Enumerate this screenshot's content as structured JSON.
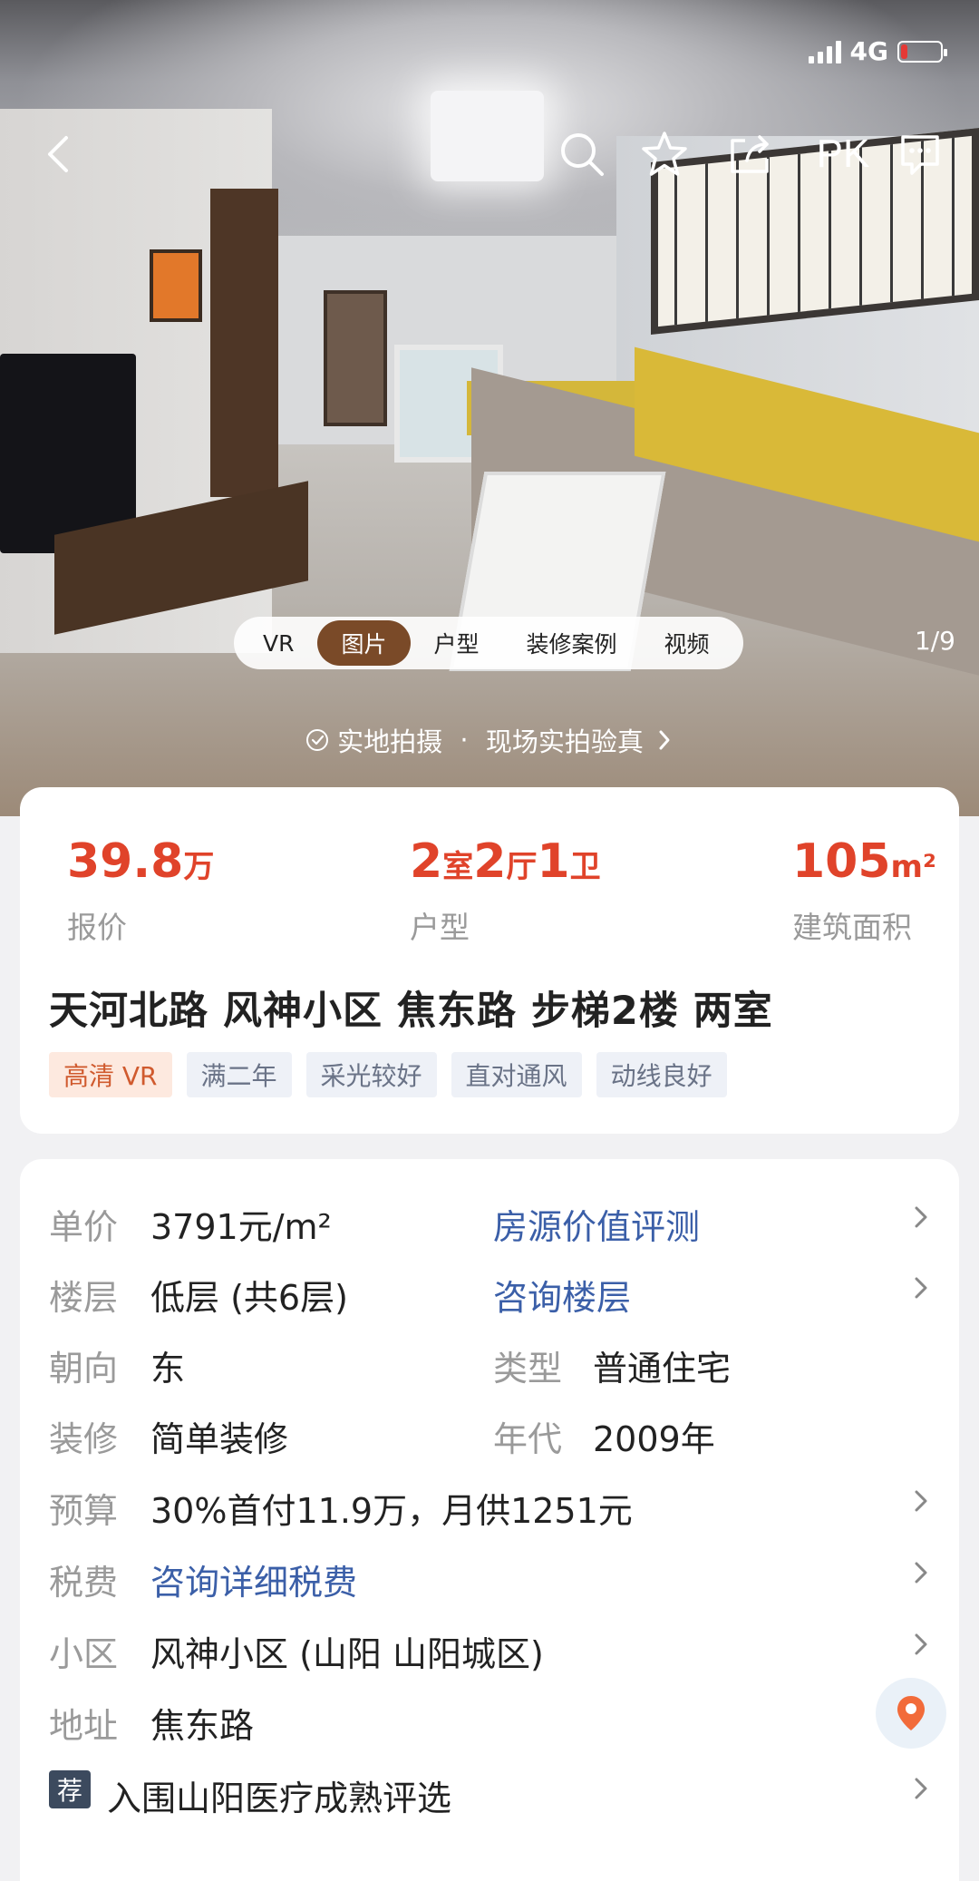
{
  "status_bar": {
    "network": "4G",
    "battery_level": 0.16,
    "battery_color": "#e53935"
  },
  "nav": {
    "back_icon": "back-arrow-icon",
    "search_icon": "search-icon",
    "favorite_icon": "star-icon",
    "share_icon": "share-icon",
    "pk_label": "PK",
    "message_icon": "message-icon"
  },
  "media_tabs": [
    {
      "label": "VR"
    },
    {
      "label": "图片"
    },
    {
      "label": "户型"
    },
    {
      "label": "装修案例"
    },
    {
      "label": "视频"
    }
  ],
  "media_active": "图片",
  "photo_counter": "1/9",
  "verify_banner": {
    "left": "实地拍摄",
    "sep": "·",
    "right": "现场实拍验真"
  },
  "summary": {
    "price": {
      "num": "39.8",
      "unit": "万",
      "label": "报价"
    },
    "layout": {
      "n1": "2",
      "u1": "室",
      "n2": "2",
      "u2": "厅",
      "n3": "1",
      "u3": "卫",
      "label": "户型"
    },
    "area": {
      "num": "105",
      "unit": "m²",
      "label": "建筑面积"
    },
    "title": "天河北路 风神小区 焦东路 步梯2楼 两室",
    "tags": [
      "高清 VR",
      "满二年",
      "采光较好",
      "直对通风",
      "动线良好"
    ]
  },
  "details": {
    "unit_price": {
      "label": "单价",
      "value": "3791元/m²",
      "link": "房源价值评测"
    },
    "floor": {
      "label": "楼层",
      "value": "低层 (共6层)",
      "link": "咨询楼层"
    },
    "orientation": {
      "label": "朝向",
      "value": "东",
      "right_label": "类型",
      "right_value": "普通住宅"
    },
    "decoration": {
      "label": "装修",
      "value": "简单装修",
      "right_label": "年代",
      "right_value": "2009年"
    },
    "budget": {
      "label": "预算",
      "value": "30%首付11.9万，月供1251元"
    },
    "tax": {
      "label": "税费",
      "value": "咨询详细税费"
    },
    "community": {
      "label": "小区",
      "value": "风神小区 (山阳 山阳城区)"
    },
    "address": {
      "label": "地址",
      "value": "焦东路"
    },
    "recommend": {
      "badge": "荐",
      "value": "入围山阳医疗成熟评选"
    }
  },
  "colors": {
    "accent_red": "#e0432a",
    "link_blue": "#3b5fa8",
    "tab_active": "#7a4a28"
  }
}
